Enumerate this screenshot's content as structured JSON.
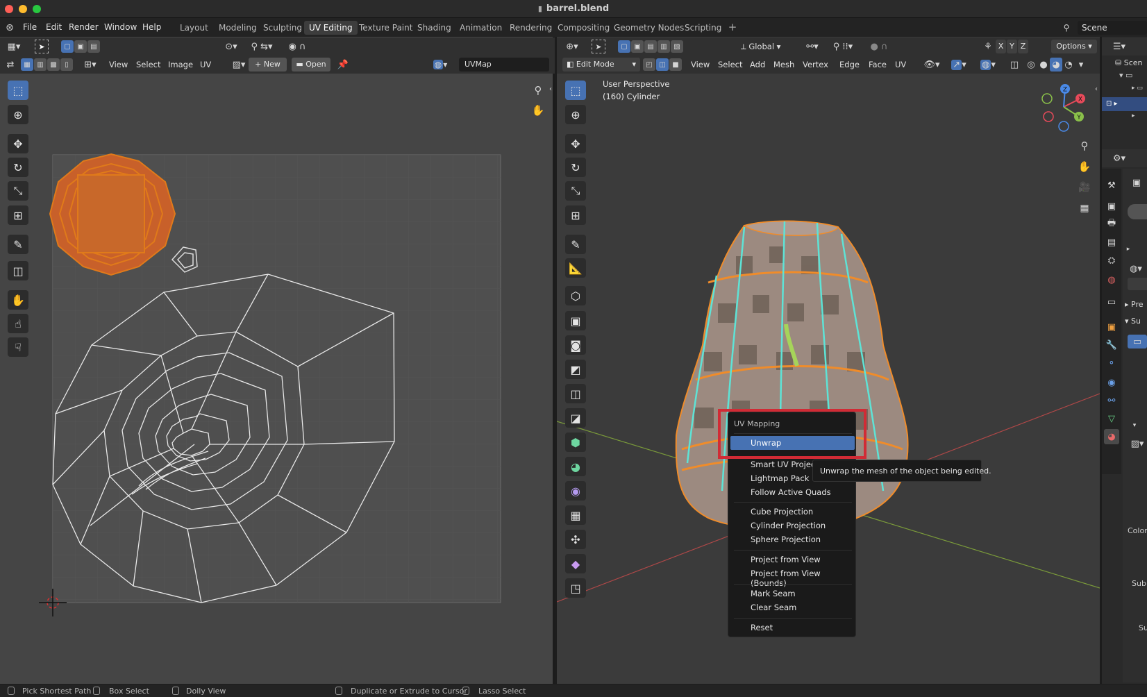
{
  "window": {
    "title": "barrel.blend"
  },
  "menus": [
    "File",
    "Edit",
    "Render",
    "Window",
    "Help"
  ],
  "workspace_tabs": [
    {
      "label": "Layout",
      "active": false
    },
    {
      "label": "Modeling",
      "active": false
    },
    {
      "label": "Sculpting",
      "active": false
    },
    {
      "label": "UV Editing",
      "active": true
    },
    {
      "label": "Texture Paint",
      "active": false
    },
    {
      "label": "Shading",
      "active": false
    },
    {
      "label": "Animation",
      "active": false
    },
    {
      "label": "Rendering",
      "active": false
    },
    {
      "label": "Compositing",
      "active": false
    },
    {
      "label": "Geometry Nodes",
      "active": false
    },
    {
      "label": "Scripting",
      "active": false
    }
  ],
  "scene": {
    "label": "Scene",
    "outliner_label": "Scen"
  },
  "uv_editor": {
    "menus": [
      "View",
      "Select",
      "Image",
      "UV"
    ],
    "new_label": "New",
    "open_label": "Open",
    "uvmap": "UVMap"
  },
  "viewport": {
    "orientation": "Global",
    "options_label": "Options",
    "mode": "Edit Mode",
    "menus": [
      "View",
      "Select",
      "Add",
      "Mesh",
      "Vertex",
      "Edge",
      "Face",
      "UV"
    ],
    "info_line1": "User Perspective",
    "info_line2": "(160) Cylinder",
    "gizmo": {
      "x": "X",
      "y": "Y",
      "z": "Z"
    },
    "axes_toggle": [
      "X",
      "Y",
      "Z"
    ]
  },
  "uv_mapping_menu": {
    "title": "UV Mapping",
    "items": [
      "Unwrap",
      "Smart UV Project",
      "Lightmap Pack",
      "Follow Active Quads",
      "Cube Projection",
      "Cylinder Projection",
      "Sphere Projection",
      "Project from View",
      "Project from View (Bounds)",
      "Mark Seam",
      "Clear Seam",
      "Reset"
    ],
    "highlighted": "Unwrap",
    "tooltip": "Unwrap the mesh of the object being edited."
  },
  "properties_fragments": {
    "pre": "Pre",
    "su": "Su",
    "color": "Color",
    "sub": "Sub",
    "su2": "Su"
  },
  "status_bar": [
    "Pick Shortest Path",
    "Box Select",
    "Dolly View",
    "Duplicate or Extrude to Cursor",
    "Lasso Select"
  ],
  "colors": {
    "accent": "#4772b3",
    "selection_orange": "#ff8c1a",
    "seam_cyan": "#5ee3d6",
    "highlight_box": "#d12b35"
  }
}
